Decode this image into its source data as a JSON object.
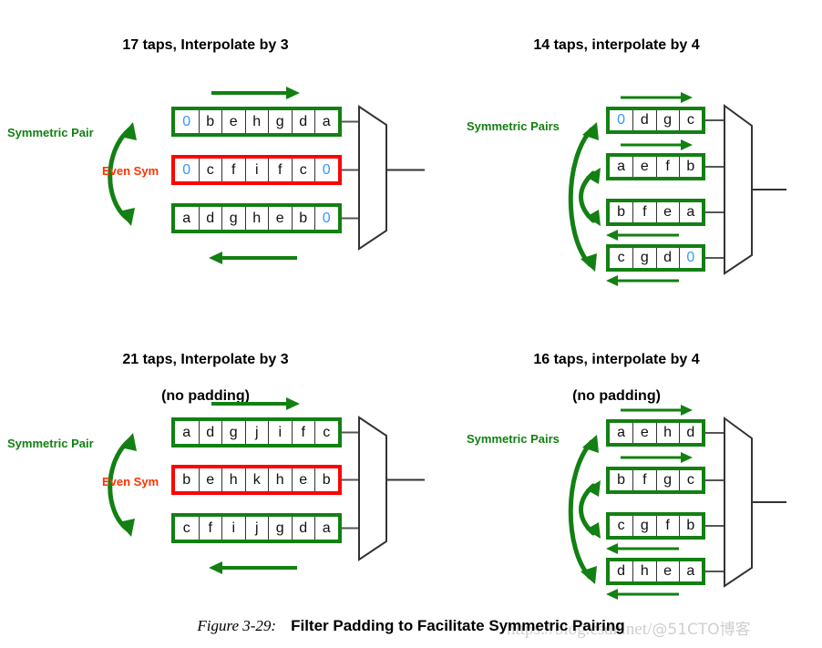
{
  "figure": {
    "number": "Figure 3-29:",
    "title": "Filter Padding to Facilitate Symmetric Pairing"
  },
  "watermark": {
    "url": "https://blog.csdn.net/",
    "handle": "@51CTO博客"
  },
  "colors": {
    "green": "#128012",
    "red": "#ff0000",
    "orange_red": "#ff3300",
    "zero_blue": "#3399ff",
    "wire": "#555555",
    "text": "#000000"
  },
  "panels": [
    {
      "id": "top-left",
      "title": "17 taps, Interpolate by 3",
      "title_lead": "17 taps",
      "title_rest": ", Interpolate by 3",
      "sym_label": "Symmetric Pair",
      "even_sym_label": "Even Sym",
      "cells_per_row": 7,
      "rows": [
        {
          "border": "green",
          "values": [
            "0",
            "b",
            "e",
            "h",
            "g",
            "d",
            "a"
          ],
          "zeros": [
            0
          ],
          "arrow_above": "right"
        },
        {
          "border": "red",
          "values": [
            "0",
            "c",
            "f",
            "i",
            "f",
            "c",
            "0"
          ],
          "zeros": [
            0,
            6
          ],
          "arrow_above": "none"
        },
        {
          "border": "green",
          "values": [
            "a",
            "d",
            "g",
            "h",
            "e",
            "b",
            "0"
          ],
          "zeros": [
            6
          ],
          "arrow_below": "left"
        }
      ]
    },
    {
      "id": "top-right",
      "title": "14 taps, interpolate by 4",
      "title_lead": "14 taps, interpolate by 4",
      "title_rest": "",
      "sym_label": "Symmetric Pairs",
      "even_sym_label": "",
      "cells_per_row": 4,
      "rows": [
        {
          "border": "green",
          "values": [
            "0",
            "d",
            "g",
            "c"
          ],
          "zeros": [
            0
          ],
          "arrow_above": "right"
        },
        {
          "border": "green",
          "values": [
            "a",
            "e",
            "f",
            "b"
          ],
          "zeros": [],
          "arrow_above": "right"
        },
        {
          "border": "green",
          "values": [
            "b",
            "f",
            "e",
            "a"
          ],
          "zeros": [],
          "arrow_below": "left"
        },
        {
          "border": "green",
          "values": [
            "c",
            "g",
            "d",
            "0"
          ],
          "zeros": [
            3
          ],
          "arrow_below": "left"
        }
      ]
    },
    {
      "id": "bottom-left",
      "title": "21 taps, Interpolate by 3\n(no padding)",
      "title_lead": "21 taps",
      "title_rest": ", Interpolate by 3",
      "title_line2": "(no padding)",
      "sym_label": "Symmetric Pair",
      "even_sym_label": "Even Sym",
      "cells_per_row": 7,
      "rows": [
        {
          "border": "green",
          "values": [
            "a",
            "d",
            "g",
            "j",
            "i",
            "f",
            "c"
          ],
          "zeros": [],
          "arrow_above": "right"
        },
        {
          "border": "red",
          "values": [
            "b",
            "e",
            "h",
            "k",
            "h",
            "e",
            "b"
          ],
          "zeros": [],
          "arrow_above": "none"
        },
        {
          "border": "green",
          "values": [
            "c",
            "f",
            "i",
            "j",
            "g",
            "d",
            "a"
          ],
          "zeros": [],
          "arrow_below": "left"
        }
      ]
    },
    {
      "id": "bottom-right",
      "title": "16 taps, interpolate by 4\n(no padding)",
      "title_lead": "16 taps, interpolate by 4",
      "title_rest": "",
      "title_line2": "(no padding)",
      "sym_label": "Symmetric Pairs",
      "even_sym_label": "",
      "cells_per_row": 4,
      "rows": [
        {
          "border": "green",
          "values": [
            "a",
            "e",
            "h",
            "d"
          ],
          "zeros": [],
          "arrow_above": "right"
        },
        {
          "border": "green",
          "values": [
            "b",
            "f",
            "g",
            "c"
          ],
          "zeros": [],
          "arrow_above": "right"
        },
        {
          "border": "green",
          "values": [
            "c",
            "g",
            "f",
            "b"
          ],
          "zeros": [],
          "arrow_below": "left"
        },
        {
          "border": "green",
          "values": [
            "d",
            "h",
            "e",
            "a"
          ],
          "zeros": [],
          "arrow_below": "left"
        }
      ]
    }
  ]
}
